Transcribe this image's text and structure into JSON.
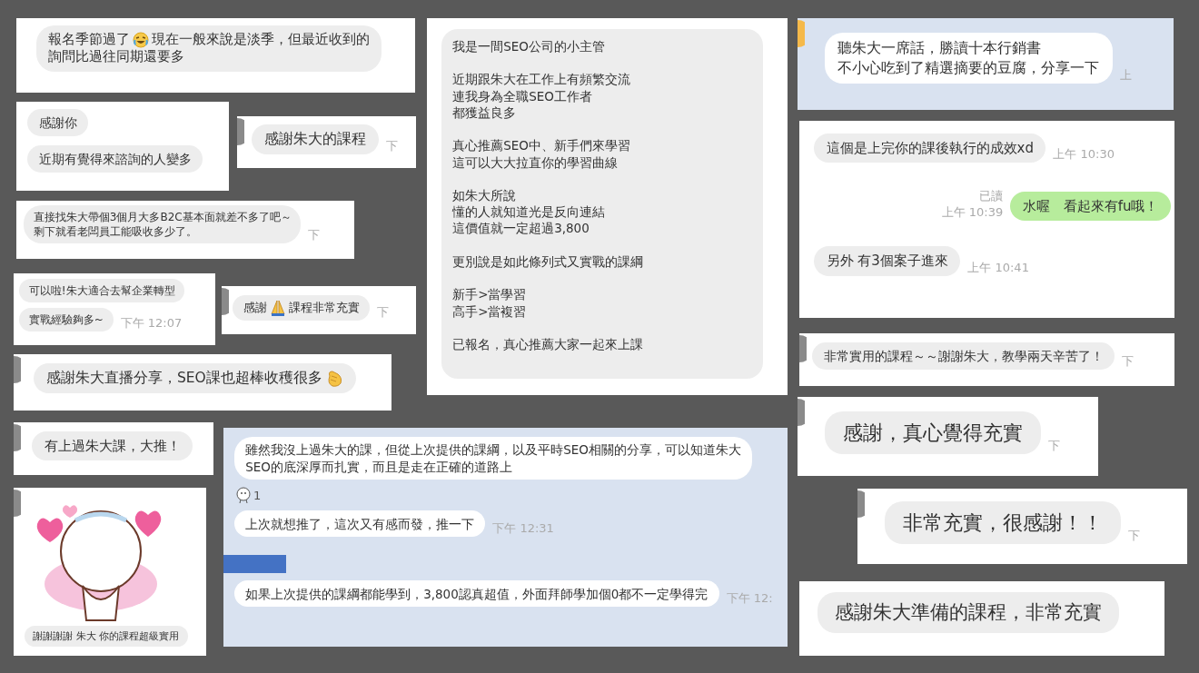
{
  "cards": [
    {
      "kind": "plain",
      "avatar": false,
      "messages": [
        {
          "kind": "bubble",
          "lines": [
            [
              {
                "kind": "text",
                "text": "報名季節過了"
              },
              {
                "kind": "laugh-emoji"
              },
              {
                "kind": "text",
                "text": "現在一般來說是淡季，但最近收到的"
              }
            ],
            [
              {
                "kind": "text",
                "text": "詢問比過往同期還要多"
              }
            ]
          ]
        }
      ]
    },
    {
      "kind": "plain",
      "avatar": false,
      "messages": [
        {
          "kind": "bubble",
          "text": "感謝你"
        },
        {
          "kind": "bubble",
          "text": "近期有覺得來諮詢的人變多"
        }
      ]
    },
    {
      "kind": "plain",
      "avatar": true,
      "messages": [
        {
          "kind": "bubble",
          "text": "感謝朱大的課程",
          "time": "下"
        }
      ]
    },
    {
      "kind": "plain",
      "avatar": false,
      "messages": [
        {
          "kind": "bubble",
          "lines": [
            [
              {
                "kind": "text",
                "text": "直接找朱大帶個3個月大多B2C基本面就差不多了吧～"
              }
            ],
            [
              {
                "kind": "text",
                "text": "剩下就看老闆員工能吸收多少了。"
              }
            ]
          ],
          "time": "下"
        }
      ]
    },
    {
      "kind": "plain",
      "avatar": false,
      "messages": [
        {
          "kind": "bubble",
          "text": "可以啦!朱大適合去幫企業轉型"
        },
        {
          "kind": "bubble",
          "text": "實戰經驗夠多~",
          "time": "下午 12:07"
        }
      ]
    },
    {
      "kind": "plain",
      "avatar": true,
      "messages": [
        {
          "kind": "bubble",
          "lines": [
            [
              {
                "kind": "text",
                "text": "感謝"
              },
              {
                "kind": "pray-emoji"
              },
              {
                "kind": "text",
                "text": "課程非常充實"
              }
            ]
          ],
          "time": "下"
        }
      ]
    },
    {
      "kind": "plain",
      "avatar": true,
      "messages": [
        {
          "kind": "bubble",
          "lines": [
            [
              {
                "kind": "text",
                "text": "感謝朱大直播分享，SEO課也超棒收穫很多"
              },
              {
                "kind": "clap-emoji"
              }
            ]
          ]
        }
      ]
    },
    {
      "kind": "plain",
      "avatar": true,
      "messages": [
        {
          "kind": "bubble",
          "text": "有上過朱大課，大推！"
        }
      ]
    },
    {
      "kind": "plain",
      "avatar": true,
      "messages": [
        {
          "kind": "sticker"
        },
        {
          "kind": "bubble",
          "text": "謝謝謝謝 朱大 你的課程超級實用"
        }
      ]
    },
    {
      "kind": "plain",
      "avatar": false,
      "messages": [
        {
          "kind": "bubble",
          "paragraphs": [
            [
              "我是一間SEO公司的小主管"
            ],
            [
              "近期跟朱大在工作上有頻繁交流",
              "連我身為全職SEO工作者",
              "都獲益良多"
            ],
            [
              "真心推薦SEO中、新手們來學習",
              "這可以大大拉直你的學習曲線"
            ],
            [
              "如朱大所說",
              "懂的人就知道光是反向連結",
              "這價值就一定超過3,800"
            ],
            [
              "更別說是如此條列式又實戰的課綱"
            ],
            [
              "新手>當學習",
              "高手>當複習"
            ],
            [
              "已報名，真心推薦大家一起來上課"
            ]
          ]
        }
      ]
    },
    {
      "kind": "tinted",
      "avatar": false,
      "messages": [
        {
          "kind": "bubble",
          "lines": [
            [
              {
                "kind": "text",
                "text": "雖然我沒上過朱大的課，但從上次提供的課綱，以及平時SEO相關的分享，可以知道朱大"
              }
            ],
            [
              {
                "kind": "text",
                "text": "SEO的底深厚而扎實，而且是走在正確的道路上"
              }
            ]
          ]
        },
        {
          "kind": "reaction",
          "count": "1"
        },
        {
          "kind": "bubble",
          "text": "上次就想推了，這次又有感而發，推一下",
          "time": "下午 12:31"
        },
        {
          "kind": "redaction"
        },
        {
          "kind": "bubble",
          "text": "如果上次提供的課綱都能學到，3,800認真超值，外面拜師學加個0都不一定學得完",
          "time": "下午 12:"
        }
      ]
    },
    {
      "kind": "tinted",
      "avatar": true,
      "messages": [
        {
          "kind": "bubble",
          "lines": [
            [
              {
                "kind": "text",
                "text": "聽朱大一席話，勝讀十本行銷書"
              }
            ],
            [
              {
                "kind": "text",
                "text": "不小心吃到了精選摘要的豆腐，分享一下"
              }
            ]
          ],
          "time": "上"
        }
      ]
    },
    {
      "kind": "plain",
      "avatar": false,
      "messages": [
        {
          "kind": "bubble",
          "text": "這個是上完你的課後執行的成效xd",
          "time": "上午 10:30"
        },
        {
          "kind": "sent",
          "text": "水喔　看起來有fu哦！",
          "read": "已讀",
          "time": "上午 10:39"
        },
        {
          "kind": "bubble",
          "text": "另外 有3個案子進來",
          "time": "上午 10:41"
        }
      ]
    },
    {
      "kind": "plain",
      "avatar": true,
      "messages": [
        {
          "kind": "bubble",
          "text": "非常實用的課程～～謝謝朱大，教學兩天辛苦了！",
          "time": "下"
        }
      ]
    },
    {
      "kind": "plain",
      "avatar": true,
      "messages": [
        {
          "kind": "bubble",
          "text": "感謝，真心覺得充實",
          "time": "下"
        }
      ]
    },
    {
      "kind": "plain",
      "avatar": true,
      "messages": [
        {
          "kind": "bubble",
          "text": "非常充實，很感謝！！",
          "time": "下"
        }
      ]
    },
    {
      "kind": "plain",
      "avatar": false,
      "messages": [
        {
          "kind": "bubble",
          "text": "感謝朱大準備的課程，非常充實"
        }
      ]
    }
  ]
}
